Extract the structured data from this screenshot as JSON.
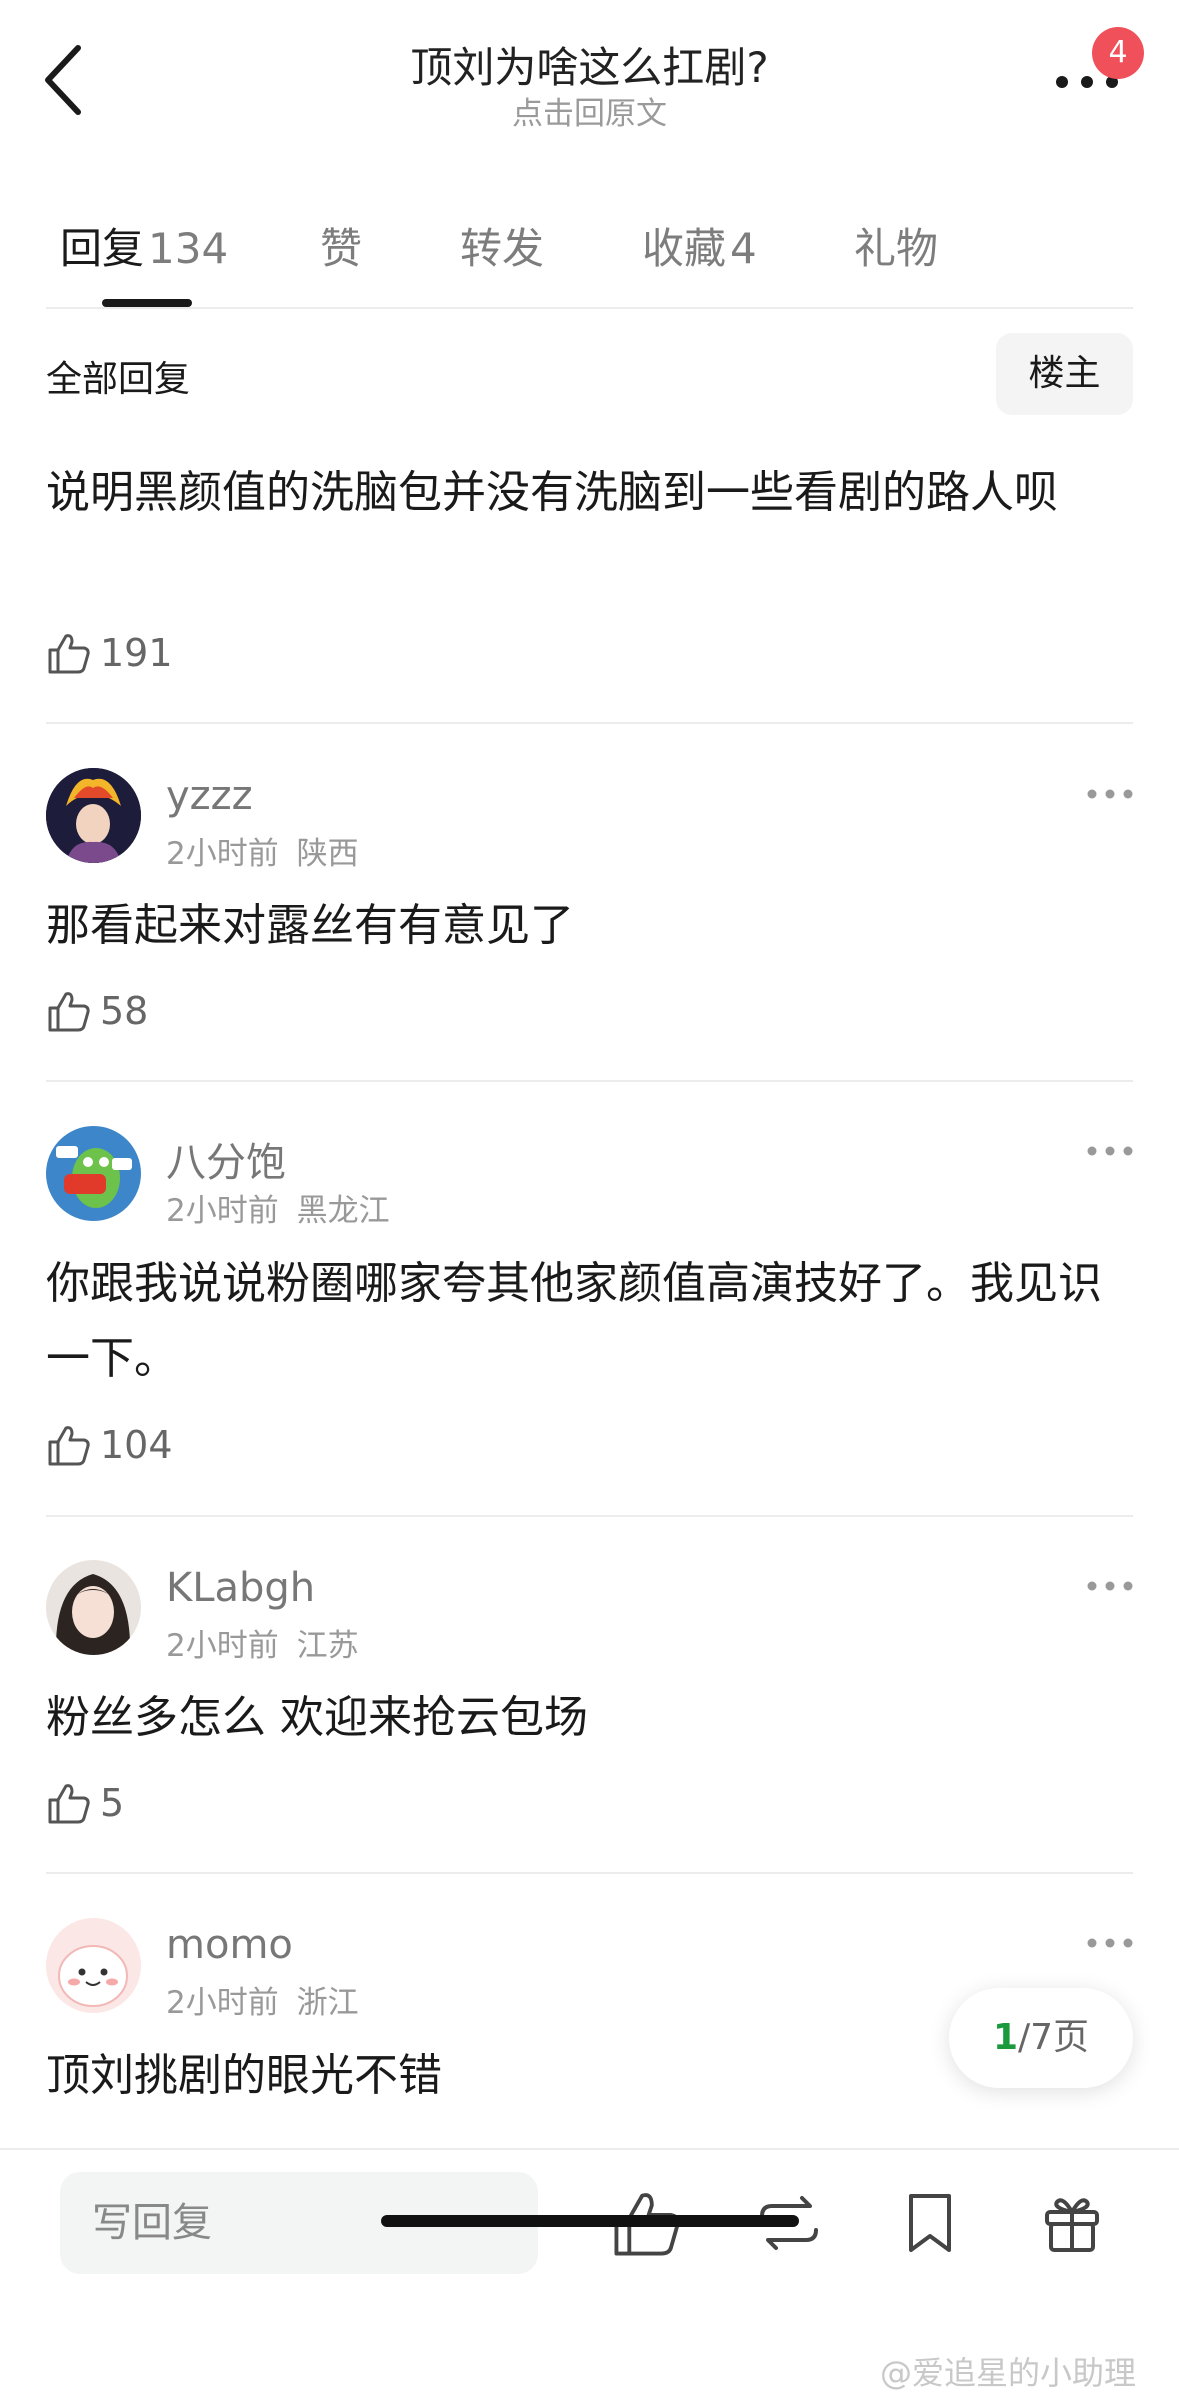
{
  "header": {
    "title": "顶刘为啥这么扛剧?",
    "subtitle": "点击回原文",
    "notification_count": "4"
  },
  "tabs": [
    {
      "label": "回复",
      "count": "134",
      "active": true
    },
    {
      "label": "赞",
      "count": ""
    },
    {
      "label": "转发",
      "count": ""
    },
    {
      "label": "收藏",
      "count": "4"
    },
    {
      "label": "礼物",
      "count": ""
    }
  ],
  "filter": {
    "label": "全部回复",
    "owner_button": "楼主"
  },
  "main_comment": {
    "text": "说明黑颜值的洗脑包并没有洗脑到一些看剧的路人呗",
    "likes": "191"
  },
  "replies": [
    {
      "username": "yzzz",
      "time": "2小时前",
      "location": "陕西",
      "text": "那看起来对露丝有有意见了",
      "likes": "58"
    },
    {
      "username": "八分饱",
      "time": "2小时前",
      "location": "黑龙江",
      "text": "你跟我说说粉圈哪家夸其他家颜值高演技好了。我见识一下。",
      "likes": "104"
    },
    {
      "username": "KLabgh",
      "time": "2小时前",
      "location": "江苏",
      "text": "粉丝多怎么 欢迎来抢云包场",
      "likes": "5"
    },
    {
      "username": "momo",
      "time": "2小时前",
      "location": "浙江",
      "text": "顶刘挑剧的眼光不错",
      "likes": ""
    }
  ],
  "pagination": {
    "current": "1",
    "rest": "/7页"
  },
  "bottom_bar": {
    "reply_placeholder": "写回复"
  },
  "watermark": "@爱追星的小助理",
  "colors": {
    "accent_green": "#1a9a3c",
    "badge_red": "#f0505a"
  }
}
